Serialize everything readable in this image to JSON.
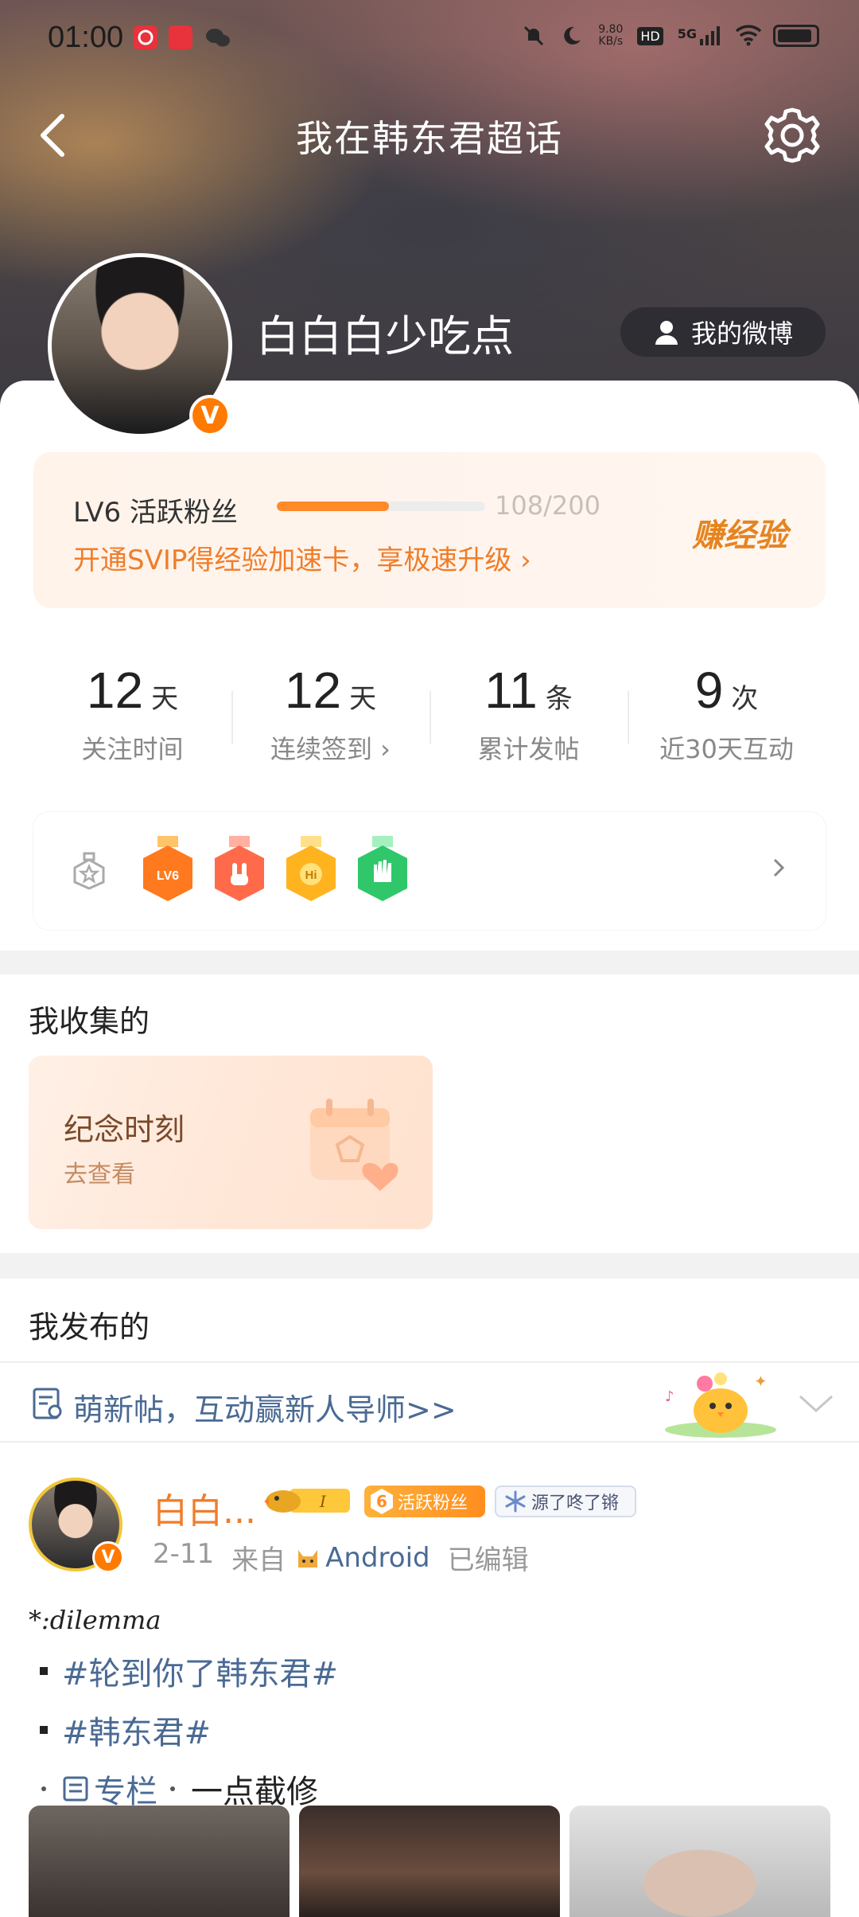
{
  "status_bar": {
    "time": "01:00",
    "net_speed_value": "9.80",
    "net_speed_unit": "KB/s",
    "hd_label": "HD",
    "network_label": "5G"
  },
  "nav": {
    "title": "我在韩东君超话"
  },
  "profile": {
    "username": "白白白少吃点",
    "verified_badge": "V",
    "my_weibo_label": "我的微博"
  },
  "level": {
    "label": "LV6 活跃粉丝",
    "progress_fraction": 0.54,
    "progress_text": "108/200",
    "svip_link": "开通SVIP得经验加速卡，享极速升级 ›",
    "earn_label": "赚经验"
  },
  "stats": [
    {
      "value": "12",
      "unit": "天",
      "label": "关注时间"
    },
    {
      "value": "12",
      "unit": "天",
      "label": "连续签到 ›"
    },
    {
      "value": "11",
      "unit": "条",
      "label": "累计发帖"
    },
    {
      "value": "9",
      "unit": "次",
      "label": "近30天互动"
    }
  ],
  "badges": {
    "items": [
      "LV6-medal",
      "rock-hand-medal",
      "hi-medal",
      "wave-hand-medal"
    ],
    "medal_colors": [
      "#ff7a1f",
      "#ff6b4a",
      "#ffb31f",
      "#2fc76a"
    ]
  },
  "collected": {
    "title": "我收集的",
    "card_title": "纪念时刻",
    "card_action": "去查看"
  },
  "published": {
    "title": "我发布的",
    "promo_text": "萌新帖，互动赢新人导师>>"
  },
  "post": {
    "author": "白白...",
    "fans_level": "6",
    "fans_label": "活跃粉丝",
    "topic_tag": "源了咚了锵",
    "date": "2-11",
    "source_prefix": "来自",
    "source": "Android",
    "edited": "已编辑",
    "handle": "*:dilemma",
    "lines": [
      {
        "bullet": "square",
        "text": "#轮到你了韩东君#"
      },
      {
        "bullet": "square",
        "text": "#韩东君#"
      }
    ],
    "column_label": "专栏",
    "column_extra": "一点截修"
  },
  "colors": {
    "accent_orange": "#f07d2a",
    "link_blue": "#4a6a94",
    "verified_orange": "#ff7a00"
  }
}
